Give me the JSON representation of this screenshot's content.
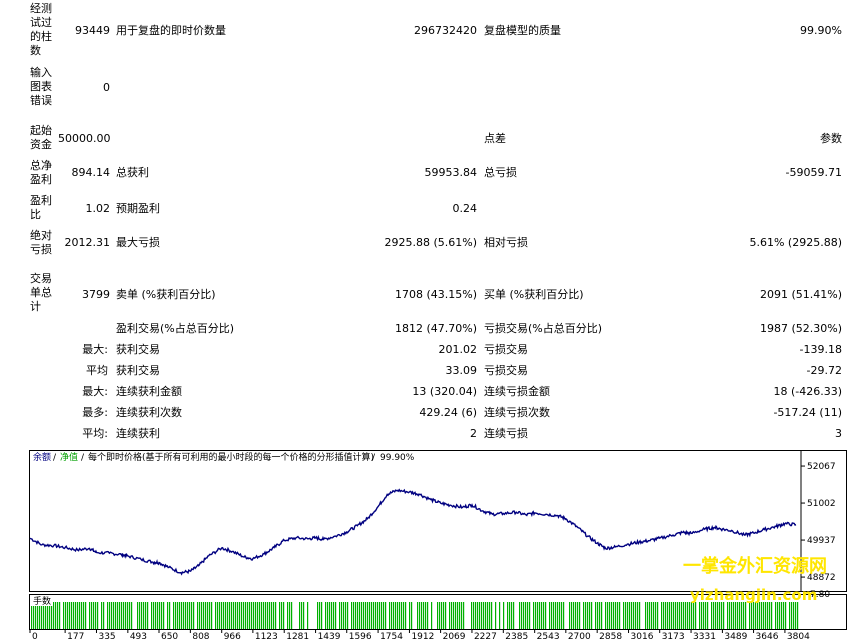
{
  "report": {
    "bars": {
      "label": "经测试过的柱数",
      "value": "93449"
    },
    "ticks": {
      "label": "用于复盘的即时价数量",
      "value": "296732420"
    },
    "quality": {
      "label": "复盘模型的质量",
      "value": "99.90%"
    },
    "errors": {
      "label": "输入图表错误",
      "value": "0"
    },
    "deposit": {
      "label": "起始资金",
      "value": "50000.00"
    },
    "spread": {
      "label": "点差",
      "value": "参数"
    },
    "net_profit": {
      "label": "总净盈利",
      "value": "894.14"
    },
    "gross_profit": {
      "label": "总获利",
      "value": "59953.84"
    },
    "gross_loss": {
      "label": "总亏损",
      "value": "-59059.71"
    },
    "profit_factor": {
      "label": "盈利比",
      "value": "1.02"
    },
    "expected_payoff": {
      "label": "预期盈利",
      "value": "0.24"
    },
    "abs_drawdown": {
      "label": "绝对亏损",
      "value": "2012.31"
    },
    "max_drawdown": {
      "label": "最大亏损",
      "value": "2925.88 (5.61%)"
    },
    "rel_drawdown": {
      "label": "相对亏损",
      "value": "5.61% (2925.88)"
    },
    "total_trades": {
      "label": "交易单总计",
      "value": "3799"
    },
    "short_positions": {
      "label": "卖单 (%获利百分比)",
      "value": "1708 (43.15%)"
    },
    "long_positions": {
      "label": "买单 (%获利百分比)",
      "value": "2091 (51.41%)"
    },
    "profit_trades": {
      "label": "盈利交易(%占总百分比)",
      "value": "1812 (47.70%)"
    },
    "loss_trades": {
      "label": "亏损交易(%占总百分比)",
      "value": "1987 (52.30%)"
    },
    "largest_profit": {
      "prefix": "最大:",
      "label": "获利交易",
      "value": "201.02"
    },
    "largest_loss": {
      "label": "亏损交易",
      "value": "-139.18"
    },
    "avg_profit": {
      "prefix": "平均",
      "label": "获利交易",
      "value": "33.09"
    },
    "avg_loss": {
      "label": "亏损交易",
      "value": "-29.72"
    },
    "max_consec_wins_money": {
      "prefix": "最大:",
      "label": "连续获利金额",
      "value": "13 (320.04)"
    },
    "max_consec_losses_money": {
      "label": "连续亏损金额",
      "value": "18 (-426.33)"
    },
    "max_consec_wins_count": {
      "prefix": "最多:",
      "label": "连续获利次数",
      "value": "429.24 (6)"
    },
    "max_consec_losses_count": {
      "label": "连续亏损次数",
      "value": "-517.24 (11)"
    },
    "avg_consec_wins": {
      "prefix": "平均:",
      "label": "连续获利",
      "value": "2"
    },
    "avg_consec_losses": {
      "label": "连续亏损",
      "value": "3"
    }
  },
  "chart_data": {
    "type": "line",
    "legend": {
      "balance": "余额",
      "equity": "净值",
      "description": "每个即时价格(基于所有可利用的最小时段的每一个价格的分形插值计算)",
      "quality": "99.90%"
    },
    "y_ticks": [
      "52067",
      "51002",
      "49937",
      "48872"
    ],
    "x_ticks": [
      "0",
      "177",
      "335",
      "493",
      "650",
      "808",
      "966",
      "1123",
      "1281",
      "1439",
      "1596",
      "1754",
      "1912",
      "2069",
      "2227",
      "2385",
      "2543",
      "2700",
      "2858",
      "3016",
      "3173",
      "3331",
      "3489",
      "3646",
      "3804"
    ],
    "volume_label": "手数",
    "volume_tick": "7.80",
    "ylim": [
      48500,
      52500
    ],
    "xlim": [
      0,
      3880
    ],
    "series": [
      {
        "color": "#000080",
        "values": [
          [
            0,
            49990
          ],
          [
            60,
            49800
          ],
          [
            120,
            49780
          ],
          [
            177,
            49720
          ],
          [
            240,
            49650
          ],
          [
            300,
            49700
          ],
          [
            335,
            49580
          ],
          [
            400,
            49560
          ],
          [
            460,
            49520
          ],
          [
            493,
            49480
          ],
          [
            560,
            49380
          ],
          [
            620,
            49300
          ],
          [
            650,
            49290
          ],
          [
            700,
            49150
          ],
          [
            760,
            49000
          ],
          [
            808,
            49040
          ],
          [
            850,
            49200
          ],
          [
            900,
            49480
          ],
          [
            966,
            49710
          ],
          [
            1020,
            49610
          ],
          [
            1080,
            49450
          ],
          [
            1123,
            49400
          ],
          [
            1180,
            49540
          ],
          [
            1230,
            49720
          ],
          [
            1281,
            49930
          ],
          [
            1340,
            50000
          ],
          [
            1400,
            49970
          ],
          [
            1439,
            50000
          ],
          [
            1480,
            49960
          ],
          [
            1540,
            50050
          ],
          [
            1596,
            50170
          ],
          [
            1650,
            50350
          ],
          [
            1700,
            50550
          ],
          [
            1754,
            50900
          ],
          [
            1800,
            51250
          ],
          [
            1850,
            51370
          ],
          [
            1912,
            51320
          ],
          [
            1960,
            51260
          ],
          [
            2020,
            51100
          ],
          [
            2069,
            51000
          ],
          [
            2120,
            50940
          ],
          [
            2180,
            50880
          ],
          [
            2227,
            50950
          ],
          [
            2280,
            50780
          ],
          [
            2330,
            50680
          ],
          [
            2385,
            50700
          ],
          [
            2450,
            50740
          ],
          [
            2500,
            50660
          ],
          [
            2543,
            50720
          ],
          [
            2600,
            50680
          ],
          [
            2660,
            50640
          ],
          [
            2700,
            50550
          ],
          [
            2760,
            50300
          ],
          [
            2810,
            50050
          ],
          [
            2858,
            49850
          ],
          [
            2900,
            49700
          ],
          [
            2950,
            49740
          ],
          [
            3016,
            49820
          ],
          [
            3070,
            49880
          ],
          [
            3120,
            49920
          ],
          [
            3173,
            49990
          ],
          [
            3240,
            50080
          ],
          [
            3290,
            50160
          ],
          [
            3331,
            50130
          ],
          [
            3400,
            50250
          ],
          [
            3450,
            50300
          ],
          [
            3489,
            50250
          ],
          [
            3540,
            50200
          ],
          [
            3600,
            50080
          ],
          [
            3646,
            50140
          ],
          [
            3700,
            50240
          ],
          [
            3760,
            50330
          ],
          [
            3804,
            50410
          ],
          [
            3860,
            50380
          ]
        ]
      }
    ]
  },
  "watermark": {
    "name": "一掌金外汇资源网",
    "url": "yizhangjin.com"
  }
}
